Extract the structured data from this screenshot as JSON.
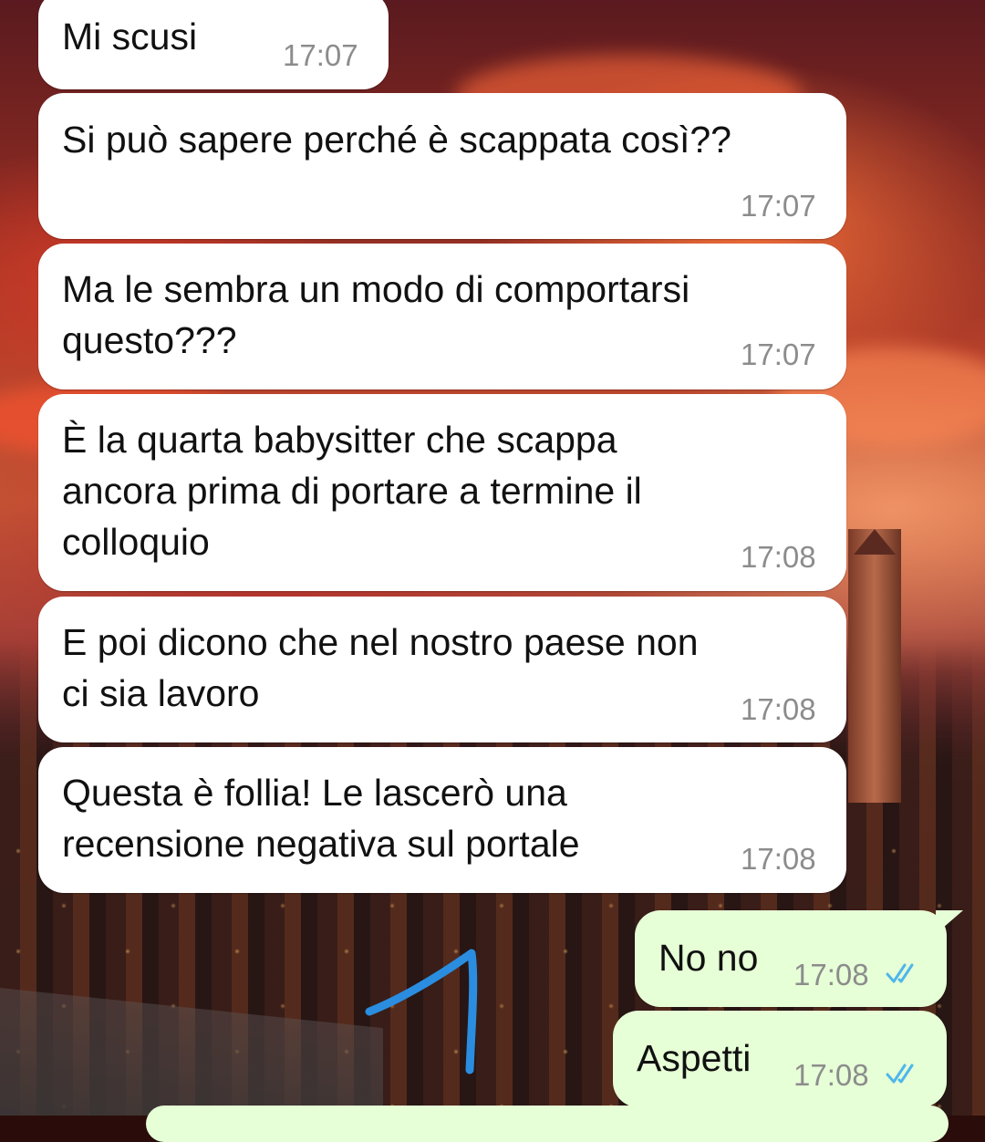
{
  "messages": [
    {
      "text": "Mi scusi",
      "time": "17:07"
    },
    {
      "text": "Si può sapere perché è scappata così??",
      "time": "17:07"
    },
    {
      "text": "Ma le sembra un modo di comportarsi\nquesto???",
      "time": "17:07"
    },
    {
      "text": "È la quarta babysitter che scappa\nancora prima di portare a termine il\ncolloquio",
      "time": "17:08"
    },
    {
      "text": "E poi dicono che nel nostro paese non\nci sia lavoro",
      "time": "17:08"
    },
    {
      "text": "Questa è follia! Le lascerò una\nrecensione negativa sul portale",
      "time": "17:08"
    }
  ],
  "replies": [
    {
      "text": "No no",
      "time": "17:08",
      "status": "read"
    },
    {
      "text": "Aspetti",
      "time": "17:08",
      "status": "read"
    }
  ],
  "colors": {
    "incoming_bubble": "#ffffff",
    "outgoing_bubble": "#e6ffd6",
    "timestamp": "#8c8c8c",
    "read_ticks": "#4fb6ec",
    "annotation_stroke": "#2a8de0"
  },
  "icons": {
    "read_receipt": "double-check-icon",
    "annotation": "hand-drawn-arrow-icon"
  }
}
